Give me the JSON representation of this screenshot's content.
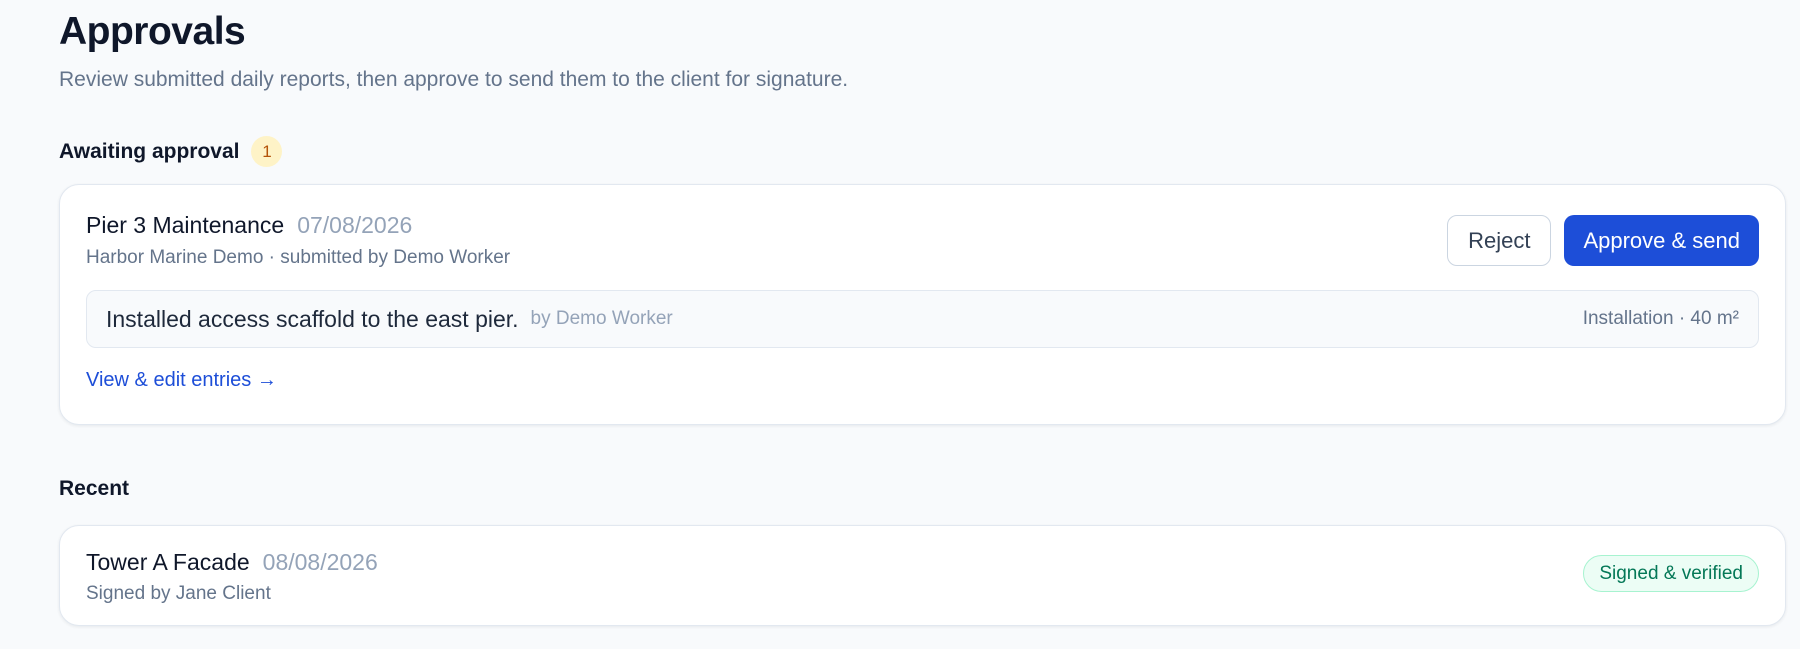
{
  "page": {
    "title": "Approvals",
    "subtitle": "Review submitted daily reports, then approve to send them to the client for signature."
  },
  "awaiting": {
    "heading": "Awaiting approval",
    "count": "1",
    "reports": [
      {
        "project": "Pier 3 Maintenance",
        "date": "07/08/2026",
        "meta": "Harbor Marine Demo · submitted by Demo Worker",
        "actions": {
          "reject_label": "Reject",
          "approve_label": "Approve & send"
        },
        "entries": [
          {
            "text": "Installed access scaffold to the east pier.",
            "author": "by Demo Worker",
            "quantity": "Installation · 40 m²"
          }
        ],
        "view_link": "View & edit entries →"
      }
    ]
  },
  "recent": {
    "heading": "Recent",
    "reports": [
      {
        "project": "Tower A Facade",
        "date": "08/08/2026",
        "meta": "Signed by Jane Client",
        "status": "Signed & verified"
      }
    ]
  },
  "colors": {
    "primary": "#1d4ed8",
    "success": "#047857",
    "warning_badge_bg": "#fef3c7",
    "warning_badge_text": "#b45309",
    "muted": "#64748b",
    "background": "#f8fafc"
  }
}
